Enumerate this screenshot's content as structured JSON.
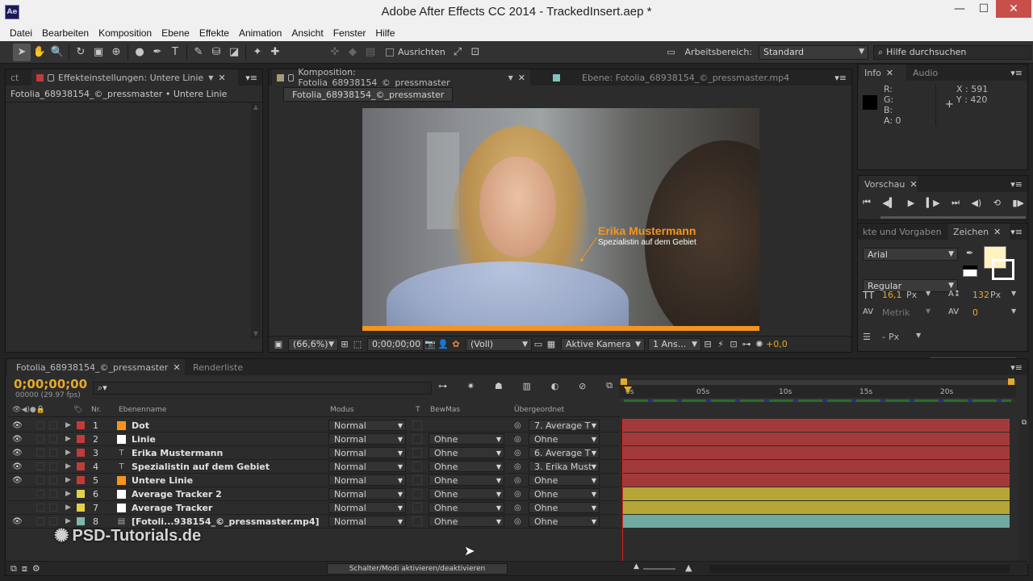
{
  "window": {
    "title": "Adobe After Effects CC 2014 - TrackedInsert.aep *",
    "logo": "Ae",
    "minimize": "—",
    "maximize": "☐",
    "close": "✕"
  },
  "menu": [
    "Datei",
    "Bearbeiten",
    "Komposition",
    "Ebene",
    "Effekte",
    "Animation",
    "Ansicht",
    "Fenster",
    "Hilfe"
  ],
  "toolbar": {
    "ausrichten_label": "Ausrichten",
    "arbeitsbereich_label": "Arbeitsbereich:",
    "arbeitsbereich_value": "Standard",
    "help_placeholder": "Hilfe durchsuchen"
  },
  "effects_panel": {
    "tab_label": "Effekteinstellungen: Untere Linie",
    "breadcrumb": "Fotolia_68938154_©_pressmaster • Untere Linie"
  },
  "comp_panel": {
    "tab_comp": "Komposition: Fotolia_68938154_©_pressmaster",
    "tab_layer": "Ebene: Fotolia_68938154_©_pressmaster.mp4",
    "comp_name": "Fotolia_68938154_©_pressmaster",
    "overlay_name": "Erika Mustermann",
    "overlay_subtitle": "Spezialistin auf dem Gebiet",
    "zoom": "(66,6%)",
    "timecode": "0;00;00;00",
    "resolution": "(Voll)",
    "camera": "Aktive Kamera",
    "views": "1 Ans...",
    "exposure": "+0,0"
  },
  "info_panel": {
    "tab_info": "Info",
    "tab_audio": "Audio",
    "r": "R:",
    "g": "G:",
    "b": "B:",
    "a": "A:",
    "a_value": "0",
    "x": "X : 591",
    "y": "Y : 420"
  },
  "preview_panel": {
    "tab": "Vorschau"
  },
  "char_panel": {
    "tab_effects": "kte und Vorgaben",
    "tab_char": "Zeichen",
    "font": "Arial",
    "style": "Regular",
    "size": "16,1",
    "size_unit": "Px",
    "leading": "132",
    "leading_unit": "Px",
    "kerning": "Metrik",
    "tracking": "0",
    "stroke": "-",
    "stroke_unit": "Px",
    "fill_color": "#fdf2c0"
  },
  "timeline": {
    "tab_comp": "Fotolia_68938154_©_pressmaster",
    "tab_render": "Renderliste",
    "timecode": "0;00;00;00",
    "frames": "00000 (29.97 fps)",
    "search_placeholder": "",
    "headers": {
      "nr": "Nr.",
      "name": "Ebenenname",
      "modus": "Modus",
      "t": "T",
      "bewmas": "BewMas",
      "parent": "Übergeordnet"
    },
    "ruler": [
      "0s",
      "05s",
      "10s",
      "15s",
      "20s"
    ],
    "footer": "Schalter/Modi aktivieren/deaktivieren",
    "layers": [
      {
        "nr": "1",
        "name": "Dot",
        "icon": "solid",
        "color": "#c13b3b",
        "swatch": "#f7941d",
        "modus": "Normal",
        "bewmas": "",
        "parent": "7. Average T",
        "bar": "#a33a3a",
        "eye": true
      },
      {
        "nr": "2",
        "name": "Linie",
        "icon": "solid",
        "color": "#c13b3b",
        "swatch": "#ffffff",
        "modus": "Normal",
        "bewmas": "Ohne",
        "parent": "Ohne",
        "bar": "#a33a3a",
        "eye": true
      },
      {
        "nr": "3",
        "name": "Erika Mustermann",
        "icon": "text",
        "color": "#c13b3b",
        "swatch": "",
        "modus": "Normal",
        "bewmas": "Ohne",
        "parent": "6. Average T",
        "bar": "#a33a3a",
        "eye": true
      },
      {
        "nr": "4",
        "name": "Spezialistin auf dem Gebiet",
        "icon": "text",
        "color": "#c13b3b",
        "swatch": "",
        "modus": "Normal",
        "bewmas": "Ohne",
        "parent": "3. Erika Must",
        "bar": "#a33a3a",
        "eye": true
      },
      {
        "nr": "5",
        "name": "Untere Linie",
        "icon": "solid",
        "color": "#c13b3b",
        "swatch": "#f7941d",
        "modus": "Normal",
        "bewmas": "Ohne",
        "parent": "Ohne",
        "bar": "#a33a3a",
        "eye": true
      },
      {
        "nr": "6",
        "name": "Average Tracker 2",
        "icon": "solid",
        "color": "#e2d04a",
        "swatch": "#ffffff",
        "modus": "Normal",
        "bewmas": "Ohne",
        "parent": "Ohne",
        "bar": "#b6a635",
        "eye": false
      },
      {
        "nr": "7",
        "name": "Average Tracker",
        "icon": "solid",
        "color": "#e2d04a",
        "swatch": "#ffffff",
        "modus": "Normal",
        "bewmas": "Ohne",
        "parent": "Ohne",
        "bar": "#b6a635",
        "eye": false
      },
      {
        "nr": "8",
        "name": "[Fotoli...938154_©_pressmaster.mp4]",
        "icon": "footage",
        "color": "#7fb7aa",
        "swatch": "",
        "modus": "Normal",
        "bewmas": "Ohne",
        "parent": "Ohne",
        "bar": "#6fa9a0",
        "eye": true
      }
    ]
  },
  "watermark": "PSD-Tutorials.de"
}
